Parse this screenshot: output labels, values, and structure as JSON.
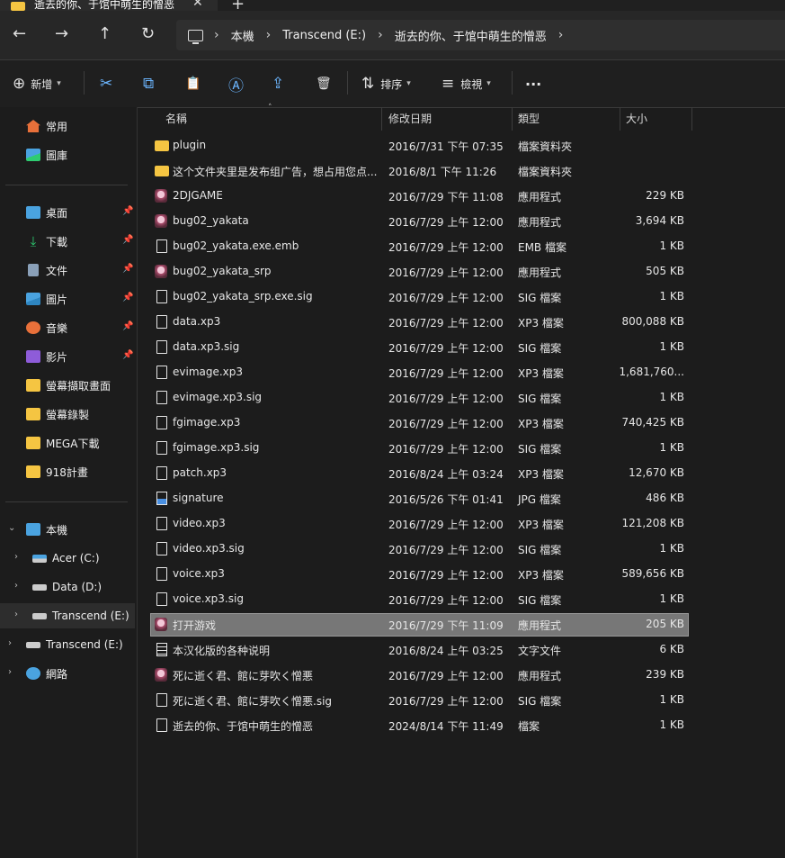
{
  "window": {
    "tab_title": "逝去的你、于馆中萌生的憎恶",
    "close_glyph": "✕",
    "new_tab_glyph": "+"
  },
  "nav": {
    "back": "←",
    "forward": "→",
    "up": "↑",
    "refresh": "↻",
    "breadcrumbs": [
      "本機",
      "Transcend (E:)",
      "逝去的你、于馆中萌生的憎恶"
    ],
    "sep": "›"
  },
  "toolbar": {
    "new_label": "新增",
    "sort_label": "排序",
    "view_label": "檢視",
    "more": "···",
    "icons": {
      "new": "⊕",
      "cut": "✂",
      "copy": "⧉",
      "paste": "📋",
      "rename": "Ⓐ",
      "share": "⇪",
      "delete": "🗑",
      "sort": "⇅",
      "view": "≡"
    }
  },
  "sidebar": {
    "home": "常用",
    "gallery": "圖庫",
    "pinned": [
      {
        "label": "桌面",
        "icon": "desktop-icon",
        "color": "#4aa3e0"
      },
      {
        "label": "下載",
        "icon": "download-icon",
        "color": "#2ecc71"
      },
      {
        "label": "文件",
        "icon": "document-icon",
        "color": "#8aa0b8"
      },
      {
        "label": "圖片",
        "icon": "pictures-icon",
        "color": "#4aa3e0"
      },
      {
        "label": "音樂",
        "icon": "music-icon",
        "color": "#e8703a"
      },
      {
        "label": "影片",
        "icon": "video-icon",
        "color": "#8e5cd9"
      }
    ],
    "folders": [
      "螢幕擷取畫面",
      "螢幕錄製",
      "MEGA下載",
      "918計畫"
    ],
    "this_pc": "本機",
    "drives": [
      "Acer (C:)",
      "Data (D:)",
      "Transcend (E:)"
    ],
    "transcend_root": "Transcend (E:)",
    "network": "網路",
    "pin_glyph": "📌",
    "expand_glyph": "›",
    "expanded_glyph": "⌄"
  },
  "columns": {
    "name": "名稱",
    "date": "修改日期",
    "type": "類型",
    "size": "大小"
  },
  "files": [
    {
      "name": "plugin",
      "date": "2016/7/31 下午 07:35",
      "type": "檔案資料夾",
      "size": "",
      "kind": "folder"
    },
    {
      "name": "这个文件夹里是发布组广告，想占用您点...",
      "date": "2016/8/1 下午 11:26",
      "type": "檔案資料夾",
      "size": "",
      "kind": "folder"
    },
    {
      "name": "2DJGAME",
      "date": "2016/7/29 下午 11:08",
      "type": "應用程式",
      "size": "229 KB",
      "kind": "app"
    },
    {
      "name": "bug02_yakata",
      "date": "2016/7/29 上午 12:00",
      "type": "應用程式",
      "size": "3,694 KB",
      "kind": "app"
    },
    {
      "name": "bug02_yakata.exe.emb",
      "date": "2016/7/29 上午 12:00",
      "type": "EMB 檔案",
      "size": "1 KB",
      "kind": "file"
    },
    {
      "name": "bug02_yakata_srp",
      "date": "2016/7/29 上午 12:00",
      "type": "應用程式",
      "size": "505 KB",
      "kind": "app"
    },
    {
      "name": "bug02_yakata_srp.exe.sig",
      "date": "2016/7/29 上午 12:00",
      "type": "SIG 檔案",
      "size": "1 KB",
      "kind": "file"
    },
    {
      "name": "data.xp3",
      "date": "2016/7/29 上午 12:00",
      "type": "XP3 檔案",
      "size": "800,088 KB",
      "kind": "file"
    },
    {
      "name": "data.xp3.sig",
      "date": "2016/7/29 上午 12:00",
      "type": "SIG 檔案",
      "size": "1 KB",
      "kind": "file"
    },
    {
      "name": "evimage.xp3",
      "date": "2016/7/29 上午 12:00",
      "type": "XP3 檔案",
      "size": "1,681,760...",
      "kind": "file"
    },
    {
      "name": "evimage.xp3.sig",
      "date": "2016/7/29 上午 12:00",
      "type": "SIG 檔案",
      "size": "1 KB",
      "kind": "file"
    },
    {
      "name": "fgimage.xp3",
      "date": "2016/7/29 上午 12:00",
      "type": "XP3 檔案",
      "size": "740,425 KB",
      "kind": "file"
    },
    {
      "name": "fgimage.xp3.sig",
      "date": "2016/7/29 上午 12:00",
      "type": "SIG 檔案",
      "size": "1 KB",
      "kind": "file"
    },
    {
      "name": "patch.xp3",
      "date": "2016/8/24 上午 03:24",
      "type": "XP3 檔案",
      "size": "12,670 KB",
      "kind": "file"
    },
    {
      "name": "signature",
      "date": "2016/5/26 下午 01:41",
      "type": "JPG 檔案",
      "size": "486 KB",
      "kind": "jpg"
    },
    {
      "name": "video.xp3",
      "date": "2016/7/29 上午 12:00",
      "type": "XP3 檔案",
      "size": "121,208 KB",
      "kind": "file"
    },
    {
      "name": "video.xp3.sig",
      "date": "2016/7/29 上午 12:00",
      "type": "SIG 檔案",
      "size": "1 KB",
      "kind": "file"
    },
    {
      "name": "voice.xp3",
      "date": "2016/7/29 上午 12:00",
      "type": "XP3 檔案",
      "size": "589,656 KB",
      "kind": "file"
    },
    {
      "name": "voice.xp3.sig",
      "date": "2016/7/29 上午 12:00",
      "type": "SIG 檔案",
      "size": "1 KB",
      "kind": "file"
    },
    {
      "name": "打开游戏",
      "date": "2016/7/29 下午 11:09",
      "type": "應用程式",
      "size": "205 KB",
      "kind": "app",
      "selected": true
    },
    {
      "name": "本汉化版的各种说明",
      "date": "2016/8/24 上午 03:25",
      "type": "文字文件",
      "size": "6 KB",
      "kind": "txt"
    },
    {
      "name": "死に逝く君、館に芽吹く憎悪",
      "date": "2016/7/29 上午 12:00",
      "type": "應用程式",
      "size": "239 KB",
      "kind": "app"
    },
    {
      "name": "死に逝く君、館に芽吹く憎悪.sig",
      "date": "2016/7/29 上午 12:00",
      "type": "SIG 檔案",
      "size": "1 KB",
      "kind": "file"
    },
    {
      "name": "逝去的你、于馆中萌生的憎恶",
      "date": "2024/8/14 下午 11:49",
      "type": "檔案",
      "size": "1 KB",
      "kind": "file"
    }
  ]
}
